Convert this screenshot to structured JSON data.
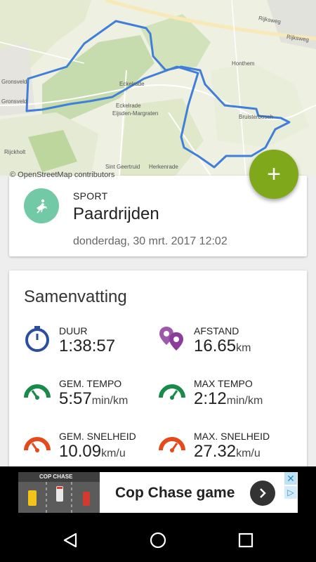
{
  "map": {
    "credit": "© OpenStreetMap contributors",
    "labels": {
      "rijksweg1": "Rijksweg",
      "rijksweg2": "Rijksweg",
      "honthem": "Honthem",
      "bruisterbosch": "Bruisterbosch",
      "eckelrade": "Eckelrade",
      "eckelrade2": "Eckelrade",
      "eijsden_margraten": "Eijsden-Margraten",
      "sint_geertruid": "Sint Geertruid",
      "herkenrade": "Herkenrade",
      "gronsveld": "Gronsveld",
      "rijckholt": "Rijckholt"
    },
    "route_color": "#3f7fd8"
  },
  "fab": {
    "label": "+"
  },
  "activity": {
    "sport_label": "SPORT",
    "sport_name": "Paardrijden",
    "date": "donderdag, 30 mrt. 2017 12:02",
    "avatar_color": "#71c9a6"
  },
  "summary": {
    "title": "Samenvatting",
    "stats": [
      {
        "label": "DUUR",
        "value": "1:38:57",
        "unit": ""
      },
      {
        "label": "AFSTAND",
        "value": "16.65",
        "unit": "km"
      },
      {
        "label": "GEM. TEMPO",
        "value": "5:57",
        "unit": "min/km"
      },
      {
        "label": "MAX TEMPO",
        "value": "2:12",
        "unit": "min/km"
      },
      {
        "label": "GEM. SNELHEID",
        "value": "10.09",
        "unit": "km/u"
      },
      {
        "label": "MAX. SNELHEID",
        "value": "27.32",
        "unit": "km/u"
      }
    ],
    "colors": {
      "duration": "#2b4f9e",
      "distance": "#8e3c9c",
      "tempo": "#1a8a4a",
      "speed": "#e54a1d"
    }
  },
  "ad": {
    "title": "Cop Chase game",
    "image_caption": "COP CHASE",
    "close": "✕",
    "choice": "▷"
  }
}
